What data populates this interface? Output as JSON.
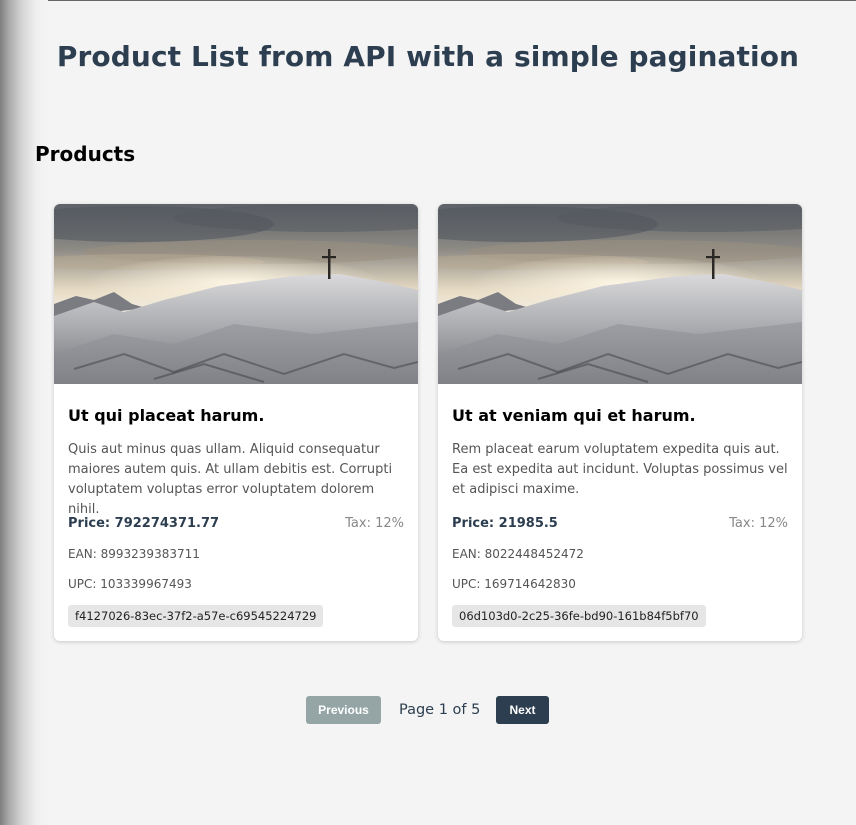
{
  "page": {
    "title": "Product List from API with a simple pagination",
    "section_title": "Products"
  },
  "products": [
    {
      "title": "Ut qui placeat harum.",
      "description": "Quis aut minus quas ullam. Aliquid consequatur maiores autem quis. At ullam debitis est. Corrupti voluptatem voluptas error voluptatem dolorem nihil.",
      "price": "Price: 792274371.77",
      "tax": "Tax: 12%",
      "ean": "EAN: 8993239383711",
      "upc": "UPC: 103339967493",
      "uuid": "f4127026-83ec-37f2-a57e-c69545224729"
    },
    {
      "title": "Ut at veniam qui et harum.",
      "description": "Rem placeat earum voluptatem expedita quis aut. Ea est expedita aut incidunt. Voluptas possimus vel et adipisci maxime.",
      "price": "Price: 21985.5",
      "tax": "Tax: 12%",
      "ean": "EAN: 8022448452472",
      "upc": "UPC: 169714642830",
      "uuid": "06d103d0-2c25-36fe-bd90-161b84f5bf70"
    }
  ],
  "pagination": {
    "previous_label": "Previous",
    "page_info": "Page 1 of 5",
    "next_label": "Next"
  },
  "colors": {
    "primary": "#2c3e50",
    "disabled_button": "#95a5a6",
    "background": "#f4f4f4"
  },
  "icons": {
    "product_image": "snowy-mountain-cross-image"
  }
}
